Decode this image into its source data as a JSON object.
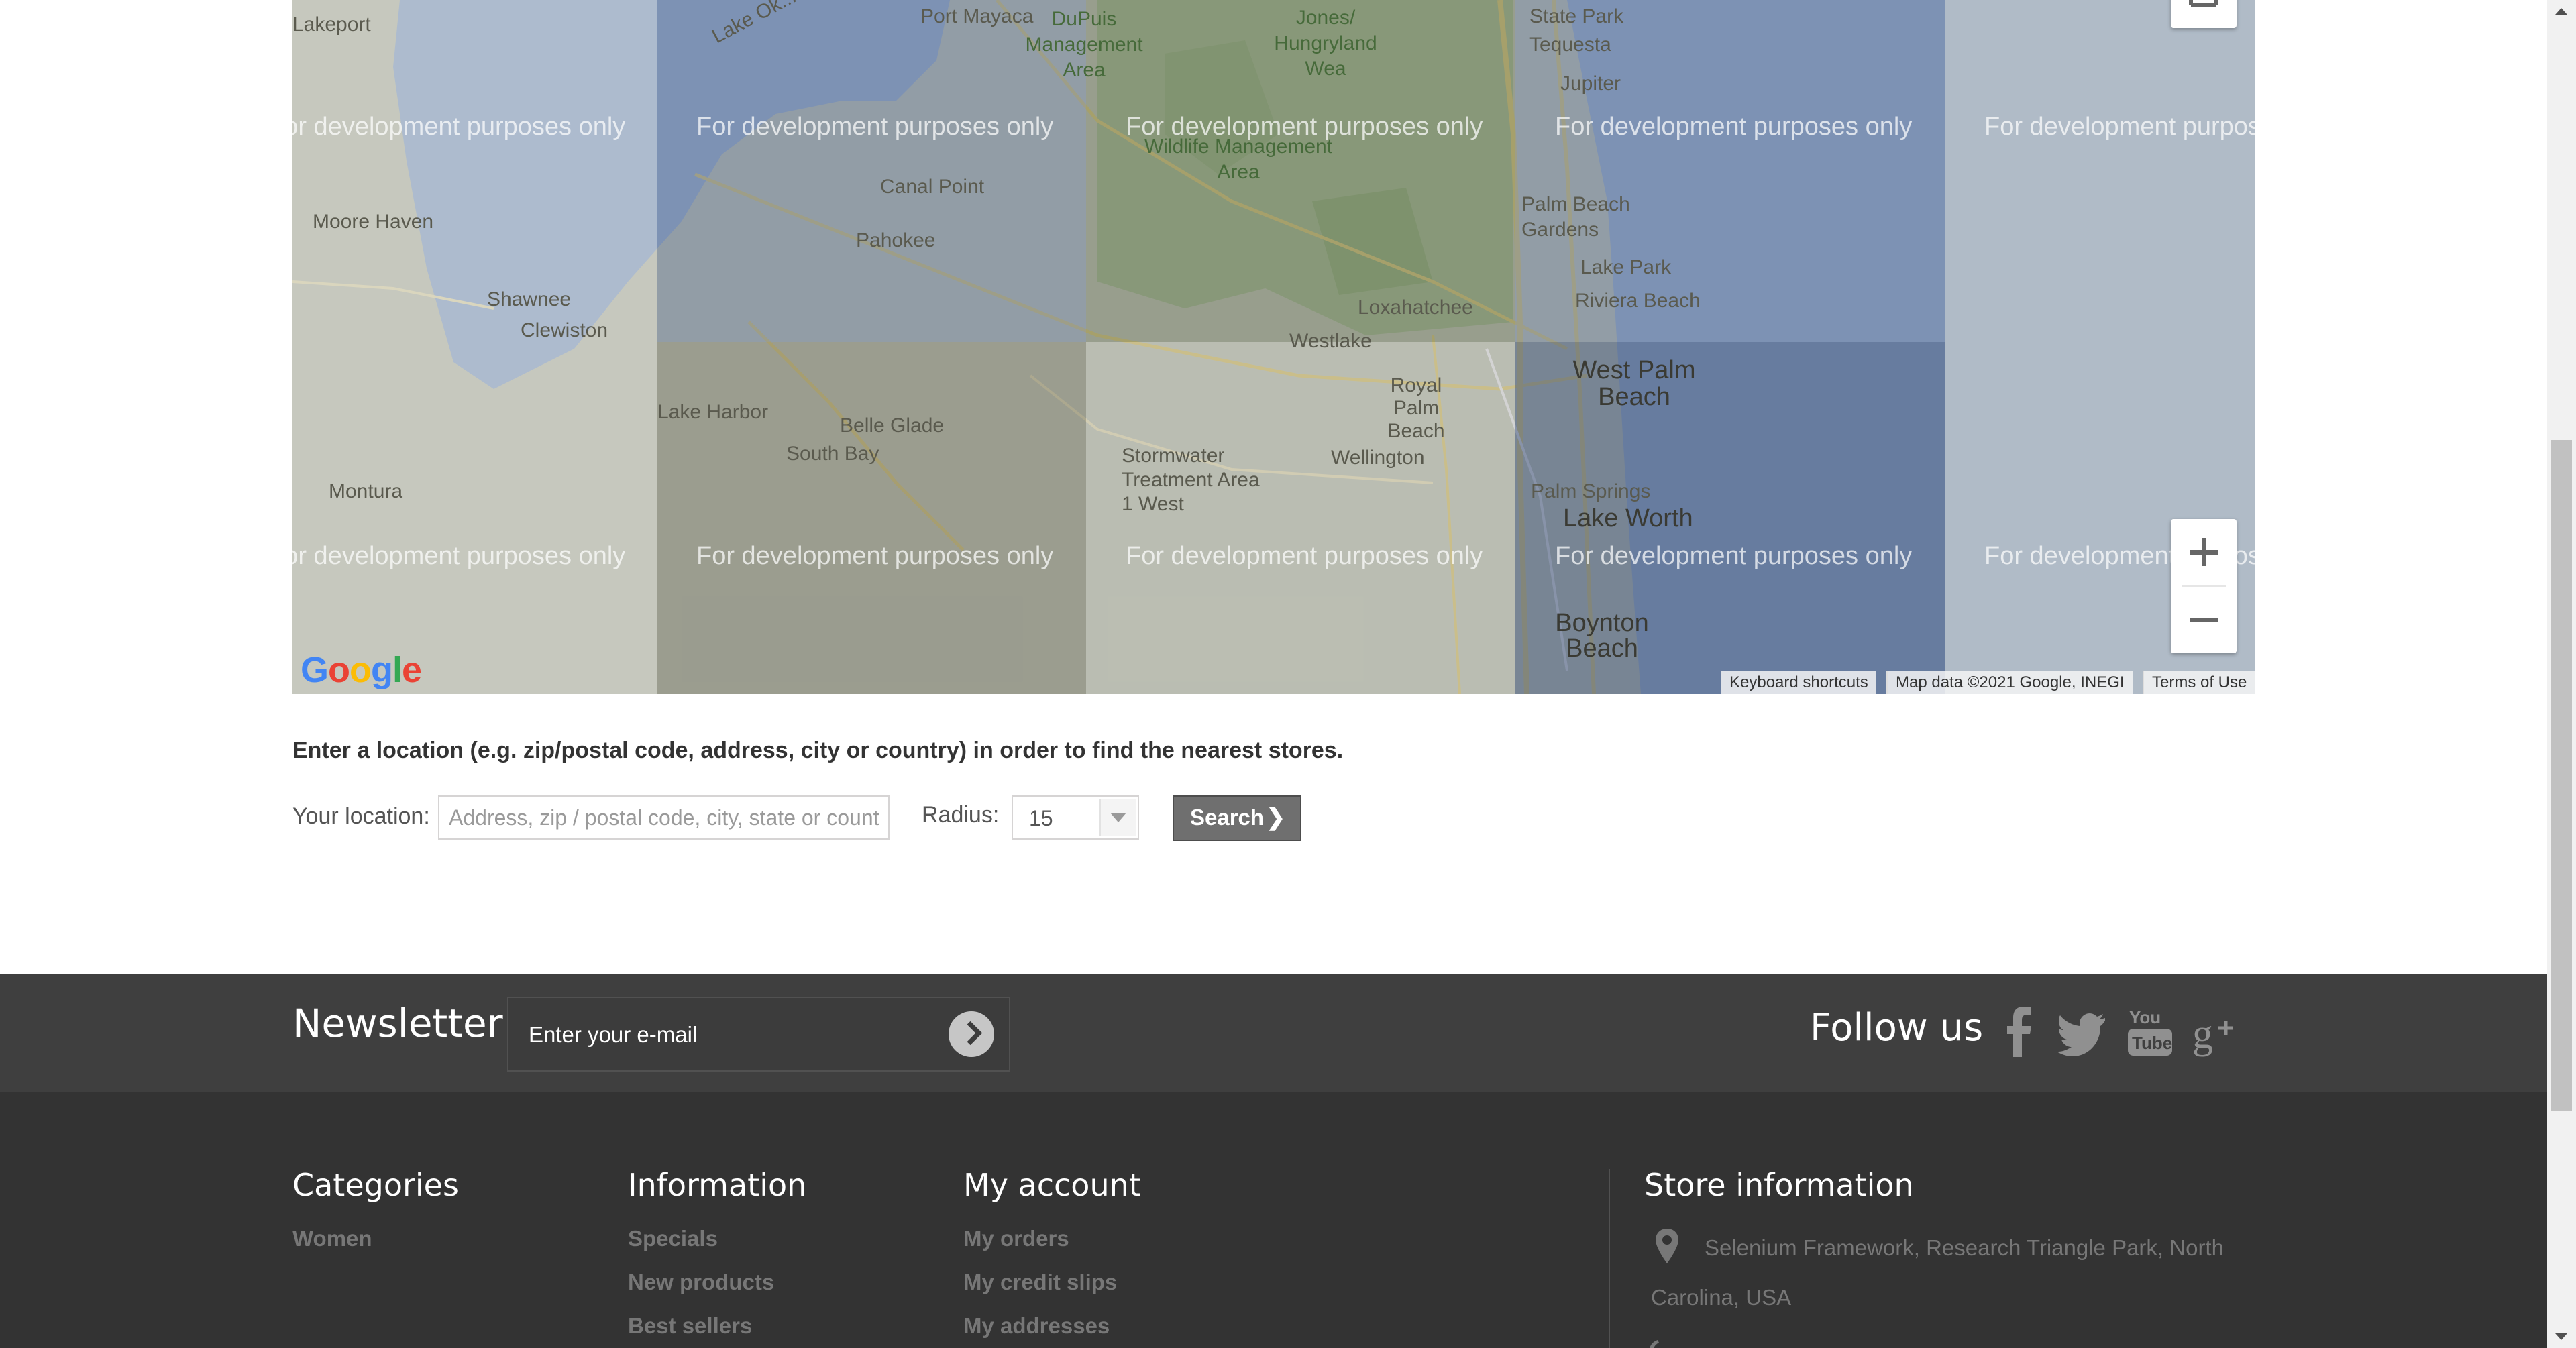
{
  "map": {
    "watermark": "For development purposes only",
    "places": {
      "lakeport": "Lakeport",
      "port_mayaca": "Port Mayaca",
      "dupuis": "DuPuis Management Area",
      "jones": "Jones/ Hungryland Wea",
      "state_park": "State Park",
      "tequesta": "Tequesta",
      "jupiter": "Jupiter",
      "wildlife": "Wildlife Management Area",
      "moore_haven": "Moore Haven",
      "canal_point": "Canal Point",
      "pahokee": "Pahokee",
      "palm_beach_gardens": "Palm Beach Gardens",
      "lake_park": "Lake Park",
      "riviera_beach": "Riviera Beach",
      "shawnee": "Shawnee",
      "clewiston": "Clewiston",
      "loxahatchee": "Loxahatchee",
      "westlake": "Westlake",
      "royal_palm_beach": "Royal Palm Beach",
      "west_palm_beach": "West Palm Beach",
      "lake_harbor": "Lake Harbor",
      "belle_glade": "Belle Glade",
      "south_bay": "South Bay",
      "stormwater": "Stormwater Treatment Area 1 West",
      "wellington": "Wellington",
      "palm_springs": "Palm Springs",
      "lake_worth": "Lake Worth",
      "montura": "Montura",
      "boynton_beach": "Boynton Beach",
      "lake_okee": "Lake Ok..."
    },
    "google_logo": "Google",
    "attribution": {
      "keyboard": "Keyboard shortcuts",
      "map_data": "Map data ©2021 Google, INEGI",
      "terms": "Terms of Use"
    }
  },
  "store_search": {
    "intro": "Enter a location (e.g. zip/postal code, address, city or country) in order to find the nearest stores.",
    "location_label": "Your location:",
    "location_placeholder": "Address, zip / postal code, city, state or country",
    "radius_label": "Radius:",
    "radius_value": "15",
    "search_label": "Search",
    "search_chevron": "❯"
  },
  "newsletter": {
    "title": "Newsletter",
    "placeholder": "Enter your e-mail",
    "follow_title": "Follow us",
    "social_icons": [
      "facebook-icon",
      "twitter-icon",
      "youtube-icon",
      "google-plus-icon"
    ]
  },
  "footer": {
    "categories": {
      "title": "Categories",
      "items": [
        "Women"
      ]
    },
    "information": {
      "title": "Information",
      "items": [
        "Specials",
        "New products",
        "Best sellers"
      ]
    },
    "my_account": {
      "title": "My account",
      "items": [
        "My orders",
        "My credit slips",
        "My addresses"
      ]
    },
    "store_info": {
      "title": "Store information",
      "address_line1": "Selenium Framework, Research Triangle Park, North",
      "address_line2": "Carolina, USA"
    }
  }
}
